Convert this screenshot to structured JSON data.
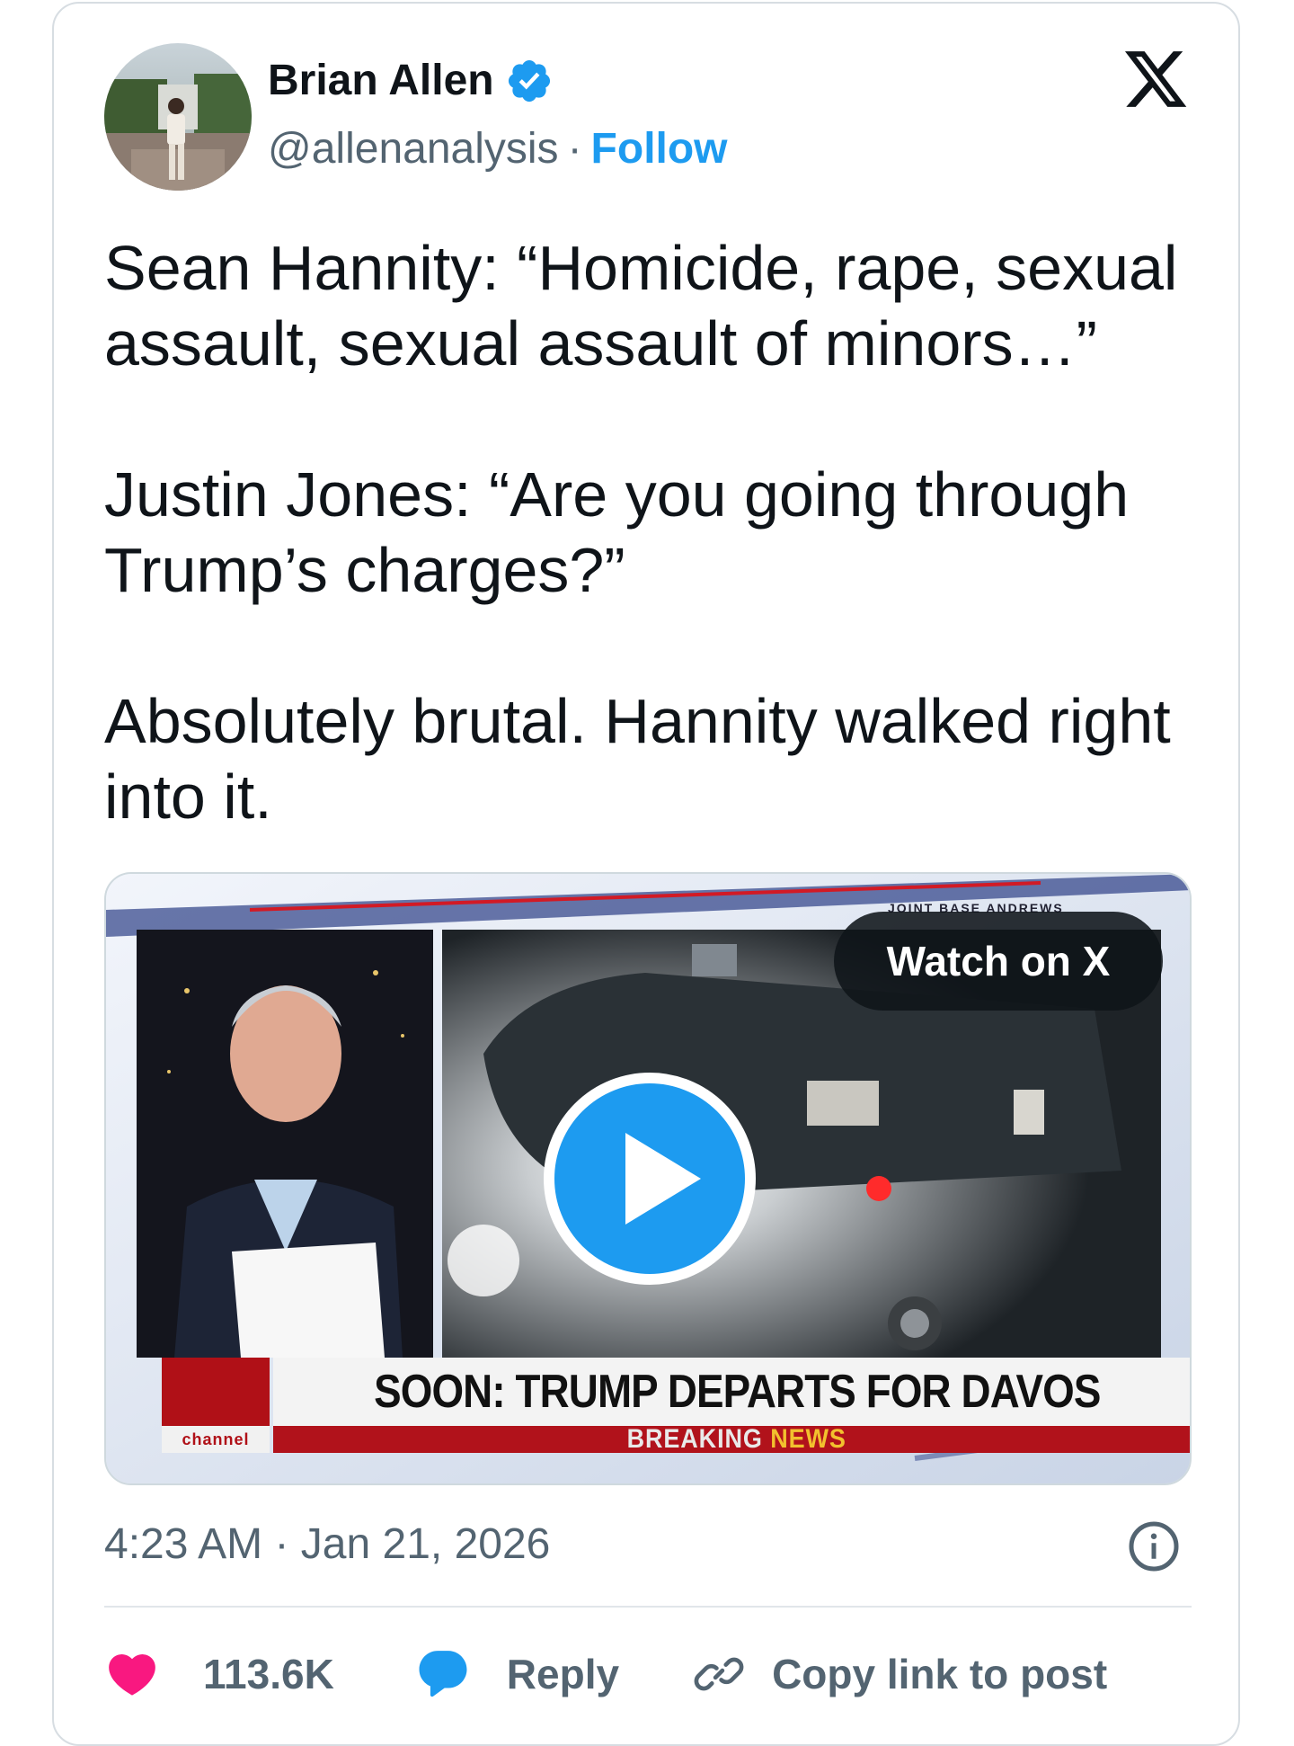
{
  "author": {
    "name": "Brian Allen",
    "handle": "@allenanalysis",
    "separator": "·",
    "follow_label": "Follow",
    "verified_badge": "verified-badge-icon"
  },
  "brand_icon": "x-logo-icon",
  "tweet": {
    "paragraphs": [
      "Sean Hannity: “Homicide, rape, sexual assault, sexual assault of minors…”",
      "Justin Jones: “Are you going through Trump’s charges?”",
      "Absolutely brutal. Hannity walked right into it."
    ]
  },
  "media": {
    "watch_label": "Watch on X",
    "play_icon": "play-icon",
    "location_tag": "JOINT BASE ANDREWS",
    "headline": "SOON: TRUMP DEPARTS FOR DAVOS",
    "breaking_word": "BREAKING",
    "news_word": "NEWS",
    "channel_label": "channel"
  },
  "meta": {
    "time": "4:23 AM",
    "separator": "·",
    "date": "Jan 21, 2026",
    "info_icon": "info-icon"
  },
  "actions": {
    "like_count": "113.6K",
    "reply_label": "Reply",
    "copy_label": "Copy link to post"
  },
  "colors": {
    "accent": "#1d9bf0",
    "like": "#f91880",
    "text": "#0f1419",
    "muted": "#536471",
    "breaking_red": "#b1121b"
  }
}
